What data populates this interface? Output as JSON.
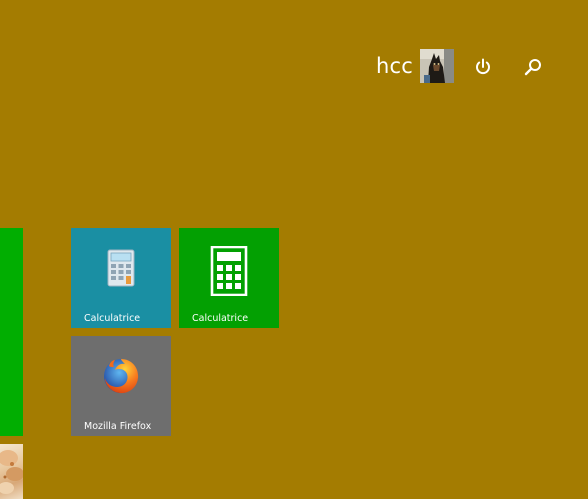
{
  "user": {
    "name": "hcc",
    "avatar_alt": "user-avatar"
  },
  "top_bar": {
    "power_icon": "power-icon",
    "search_icon": "search-icon"
  },
  "tiles": [
    {
      "label": "Calculatrice",
      "icon": "desktop-calculator-icon",
      "color": "#1a8fa3"
    },
    {
      "label": "Calculatrice",
      "icon": "calculator-icon",
      "color": "#03a002"
    },
    {
      "label": "Mozilla Firefox",
      "icon": "firefox-icon",
      "color": "#6e6e6e"
    }
  ],
  "colors": {
    "background": "#a47c01",
    "edge_tile_green": "#01ae01"
  }
}
